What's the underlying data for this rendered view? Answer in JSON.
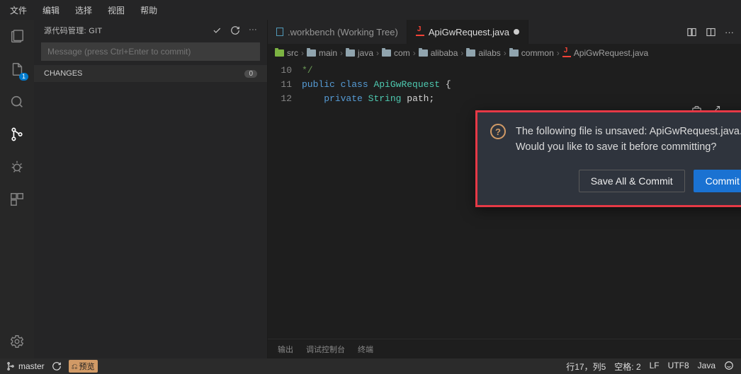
{
  "menu": {
    "items": [
      "文件",
      "编辑",
      "选择",
      "视图",
      "帮助"
    ]
  },
  "activity": {
    "badge_files": "1"
  },
  "sidebar": {
    "title": "源代码管理: GIT",
    "commit_placeholder": "Message (press Ctrl+Enter to commit)",
    "changes_label": "CHANGES",
    "changes_count": "0"
  },
  "tabs": {
    "t0": {
      "label": ".workbench (Working Tree)"
    },
    "t1": {
      "label": "ApiGwRequest.java"
    }
  },
  "breadcrumbs": [
    "src",
    "main",
    "java",
    "com",
    "alibaba",
    "ailabs",
    "common",
    "ApiGwRequest.java"
  ],
  "code": {
    "lines": [
      "10",
      "11",
      "12"
    ],
    "l10": "*/",
    "l11_a": "public",
    "l11_b": "class",
    "l11_c": "ApiGwRequest",
    "l11_d": "{",
    "l12_a": "private",
    "l12_b": "String",
    "l12_c": "path;"
  },
  "dialog": {
    "message": "The following file is unsaved: ApiGwRequest.java. Would you like to save it before committing?",
    "btn_save": "Save All & Commit",
    "btn_anyway": "Commit Anyway"
  },
  "panel": {
    "tabs": [
      "输出",
      "调试控制台",
      "终端"
    ]
  },
  "status": {
    "branch": "master",
    "preview": "预览",
    "ln_col": "行17，列5",
    "spaces": "空格: 2",
    "eol": "LF",
    "encoding": "UTF8",
    "lang": "Java"
  }
}
